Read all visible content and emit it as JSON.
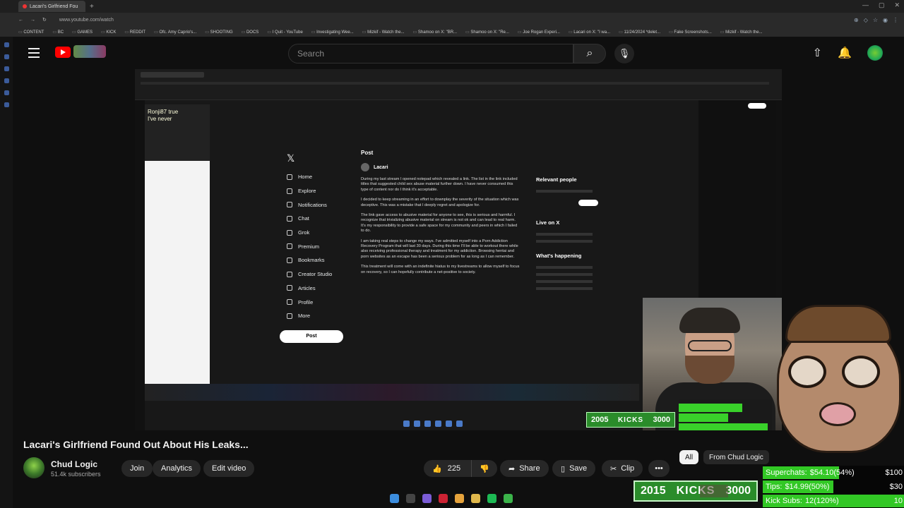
{
  "browser": {
    "tab_title": "Lacari's Girlfriend Fou",
    "url": "www.youtube.com/watch",
    "bookmarks": [
      "CONTENT",
      "BC",
      "GAMES",
      "KICK",
      "REDDIT",
      "Ofc. Amy Caprio's...",
      "SHOOTING",
      "DOCS",
      "I Quit - YouTube",
      "Investigating Wee...",
      "Mizkif - Watch the...",
      "Shamoo on X: \"BR...",
      "Shamoo on X: \"Re...",
      "Joe Rogan Experi...",
      "Lacari on X: \"I wa...",
      "11/24/2024 *delet...",
      "Fake Screenshots...",
      "Mizkif - Watch the..."
    ]
  },
  "header": {
    "search_placeholder": "Search"
  },
  "embedded": {
    "x_nav": [
      "Home",
      "Explore",
      "Notifications",
      "Chat",
      "Grok",
      "Premium",
      "Bookmarks",
      "Creator Studio",
      "Articles",
      "Profile",
      "More"
    ],
    "x_post_button": "Post",
    "post_header": "Post",
    "post_author": "Lacari",
    "post_paragraphs": [
      "During my last stream I opened notepad which revealed a link. The list in the link included titles that suggested child sex abuse material further down. I have never consumed this type of content nor do I think it's acceptable.",
      "I decided to keep streaming in an effort to downplay the severity of the situation which was deceptive. This was a mistake that I deeply regret and apologize for.",
      "The link gave access to abusive material for anyone to see, this is serious and harmful. I recognize that trivializing abusive material on stream is not ok and can lead to real harm. It's my responsibility to provide a safe space for my community and peers in which I failed to do.",
      "I am taking real steps to change my ways. I've admitted myself into a Porn Addiction Recovery Program that will last 30 days. During this time I'll be able to workout there while also receiving professional therapy and treatment for my addiction. Browsing hentai and porn websites as an escape has been a serious problem for as long as I can remember.",
      "This treatment will come with an indefinite hiatus to my livestreams to allow myself to focus on recovery, so I can hopefully contribute a net-positive to society."
    ],
    "right_headings": [
      "Relevant people",
      "Live on X",
      "What's happening"
    ],
    "kicks": {
      "current": "2005",
      "label": "KICKS",
      "goal": "3000"
    }
  },
  "video": {
    "title": "Lacari's Girlfriend Found Out About His Leaks...",
    "channel": "Chud Logic",
    "subscribers": "51.4k subscribers",
    "likes": "225",
    "buttons": {
      "join": "Join",
      "analytics": "Analytics",
      "edit": "Edit video",
      "share": "Share",
      "save": "Save",
      "clip": "Clip",
      "more": "•••"
    }
  },
  "chips": [
    "All",
    "From Chud Logic"
  ],
  "overlay": {
    "kicks": {
      "current": "2015",
      "label": "KICKS",
      "goal": "3000"
    },
    "supers": [
      {
        "label": "Superchats:",
        "value": "$54.10(54%)",
        "goal": "$100",
        "pct": 54
      },
      {
        "label": "Tips:",
        "value": "$14.99(50%)",
        "goal": "$30",
        "pct": 50
      },
      {
        "label": "Kick Subs:",
        "value": "12(120%)",
        "goal": "10",
        "pct": 100
      }
    ]
  },
  "colors": {
    "accent_green": "#32c825",
    "youtube_red": "#ff0000"
  }
}
